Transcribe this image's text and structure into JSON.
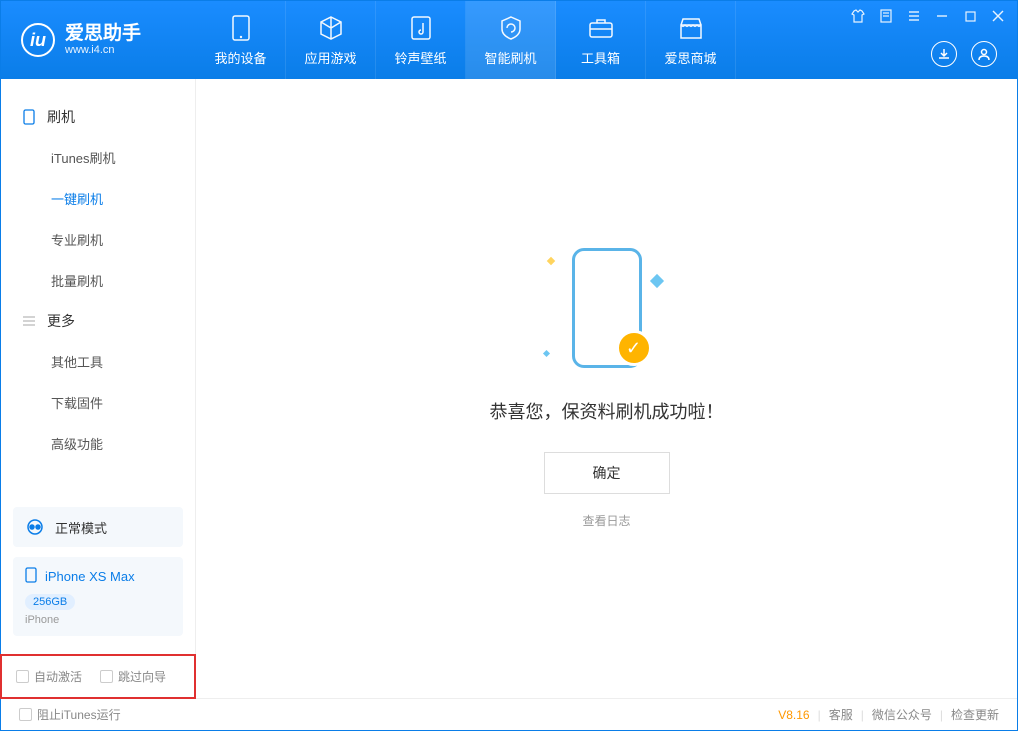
{
  "app": {
    "name": "爱思助手",
    "domain": "www.i4.cn"
  },
  "nav": {
    "tabs": [
      {
        "label": "我的设备"
      },
      {
        "label": "应用游戏"
      },
      {
        "label": "铃声壁纸"
      },
      {
        "label": "智能刷机"
      },
      {
        "label": "工具箱"
      },
      {
        "label": "爱思商城"
      }
    ]
  },
  "sidebar": {
    "group1_title": "刷机",
    "items1": [
      {
        "label": "iTunes刷机"
      },
      {
        "label": "一键刷机"
      },
      {
        "label": "专业刷机"
      },
      {
        "label": "批量刷机"
      }
    ],
    "group2_title": "更多",
    "items2": [
      {
        "label": "其他工具"
      },
      {
        "label": "下载固件"
      },
      {
        "label": "高级功能"
      }
    ]
  },
  "device": {
    "mode": "正常模式",
    "name": "iPhone XS Max",
    "storage": "256GB",
    "type": "iPhone"
  },
  "options": {
    "auto_activate": "自动激活",
    "skip_wizard": "跳过向导"
  },
  "main": {
    "success_text": "恭喜您，保资料刷机成功啦！",
    "ok_btn": "确定",
    "view_log": "查看日志"
  },
  "footer": {
    "block_itunes": "阻止iTunes运行",
    "version": "V8.16",
    "links": [
      "客服",
      "微信公众号",
      "检查更新"
    ]
  }
}
